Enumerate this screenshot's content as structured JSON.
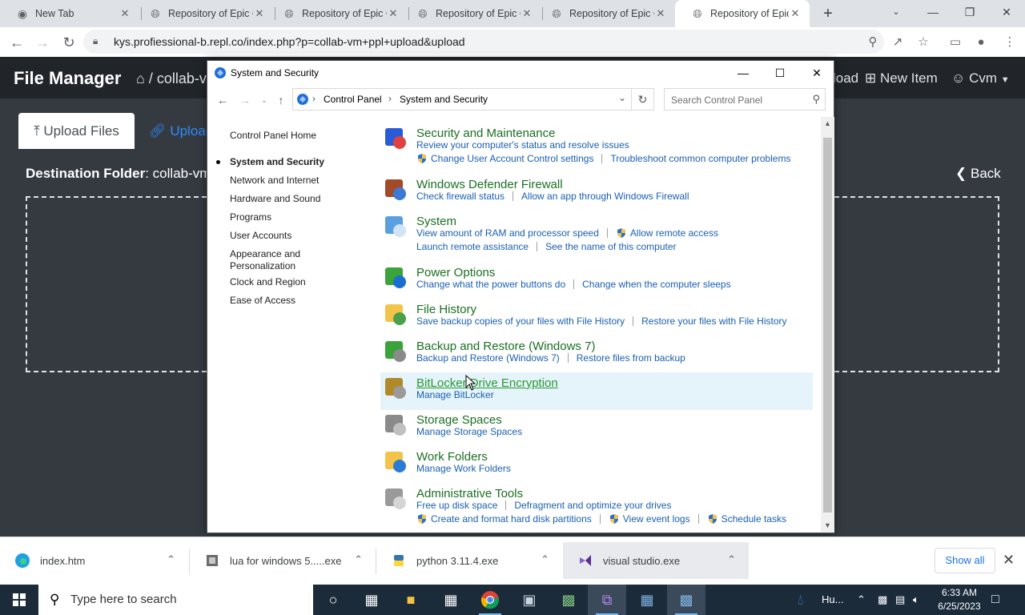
{
  "browser": {
    "tabs": [
      {
        "title": "New Tab"
      },
      {
        "title": "Repository of Epic Codes"
      },
      {
        "title": "Repository of Epic Codes"
      },
      {
        "title": "Repository of Epic Codes"
      },
      {
        "title": "Repository of Epic Codes"
      },
      {
        "title": "Repository of Epic Codes"
      }
    ],
    "active_tab": 5,
    "url": "kys.profiessional-b.repl.co/index.php?p=collab-vm+ppl+upload&upload"
  },
  "webapp": {
    "brand": "File Manager",
    "breadcrumb": "/ collab-vm",
    "nav_upload": "load",
    "nav_new_item": "New Item",
    "nav_user": "Cvm",
    "upload_files_tab": "Upload Files",
    "upload_from_url": "Upload",
    "dest_label": "Destination Folder",
    "dest_value": ": collab-vm",
    "back_label": "Back"
  },
  "control_panel": {
    "window_title": "System and Security",
    "address": [
      "Control Panel",
      "System and Security"
    ],
    "search_placeholder": "Search Control Panel",
    "sidebar": [
      {
        "label": "Control Panel Home"
      },
      {
        "label": "System and Security",
        "current": true
      },
      {
        "label": "Network and Internet"
      },
      {
        "label": "Hardware and Sound"
      },
      {
        "label": "Programs"
      },
      {
        "label": "User Accounts"
      },
      {
        "label": "Appearance and"
      },
      {
        "label": "Personalization"
      },
      {
        "label": "Clock and Region"
      },
      {
        "label": "Ease of Access"
      }
    ],
    "categories": [
      {
        "title": "Security and Maintenance",
        "icon": "flag-icon",
        "rows": [
          [
            {
              "text": "Review your computer's status and resolve issues"
            }
          ],
          [
            {
              "text": "Change User Account Control settings",
              "shield": true
            },
            {
              "text": "Troubleshoot common computer problems"
            }
          ]
        ]
      },
      {
        "title": "Windows Defender Firewall",
        "icon": "firewall-icon",
        "rows": [
          [
            {
              "text": "Check firewall status"
            },
            {
              "text": "Allow an app through Windows Firewall"
            }
          ]
        ]
      },
      {
        "title": "System",
        "icon": "computer-icon",
        "rows": [
          [
            {
              "text": "View amount of RAM and processor speed"
            },
            {
              "text": "Allow remote access",
              "shield": true
            }
          ],
          [
            {
              "text": "Launch remote assistance"
            },
            {
              "text": "See the name of this computer"
            }
          ]
        ]
      },
      {
        "title": "Power Options",
        "icon": "power-icon",
        "rows": [
          [
            {
              "text": "Change what the power buttons do"
            },
            {
              "text": "Change when the computer sleeps"
            }
          ]
        ]
      },
      {
        "title": "File History",
        "icon": "file-history-icon",
        "rows": [
          [
            {
              "text": "Save backup copies of your files with File History"
            },
            {
              "text": "Restore your files with File History"
            }
          ]
        ]
      },
      {
        "title": "Backup and Restore (Windows 7)",
        "icon": "backup-icon",
        "rows": [
          [
            {
              "text": "Backup and Restore (Windows 7)"
            },
            {
              "text": "Restore files from backup"
            }
          ]
        ]
      },
      {
        "title": "BitLocker Drive Encryption",
        "icon": "bitlocker-icon",
        "hover": true,
        "rows": [
          [
            {
              "text": "Manage BitLocker"
            }
          ]
        ]
      },
      {
        "title": "Storage Spaces",
        "icon": "storage-icon",
        "rows": [
          [
            {
              "text": "Manage Storage Spaces"
            }
          ]
        ]
      },
      {
        "title": "Work Folders",
        "icon": "work-folders-icon",
        "rows": [
          [
            {
              "text": "Manage Work Folders"
            }
          ]
        ]
      },
      {
        "title": "Administrative Tools",
        "icon": "admin-tools-icon",
        "rows": [
          [
            {
              "text": "Free up disk space"
            },
            {
              "text": "Defragment and optimize your drives"
            }
          ],
          [
            {
              "text": "Create and format hard disk partitions",
              "shield": true
            },
            {
              "text": "View event logs",
              "shield": true
            },
            {
              "text": "Schedule tasks",
              "shield": true
            }
          ]
        ]
      }
    ]
  },
  "downloads": [
    {
      "name": "index.htm",
      "icon": "edge-icon"
    },
    {
      "name": "lua for windows 5.....exe",
      "icon": "installer-icon"
    },
    {
      "name": "python 3.11.4.exe",
      "icon": "python-icon"
    },
    {
      "name": "visual studio.exe",
      "icon": "visual-studio-icon",
      "selected": true
    }
  ],
  "download_bar": {
    "show_all": "Show all"
  },
  "taskbar": {
    "search_placeholder": "Type here to search",
    "weather": "Hu...",
    "time": "6:33 AM",
    "date": "6/25/2023"
  },
  "colors": {
    "cp_link": "#1a5fb4",
    "cp_title": "#1b6f23",
    "webapp_bg": "#343a40",
    "taskbar_bg": "#1b2b3a"
  }
}
